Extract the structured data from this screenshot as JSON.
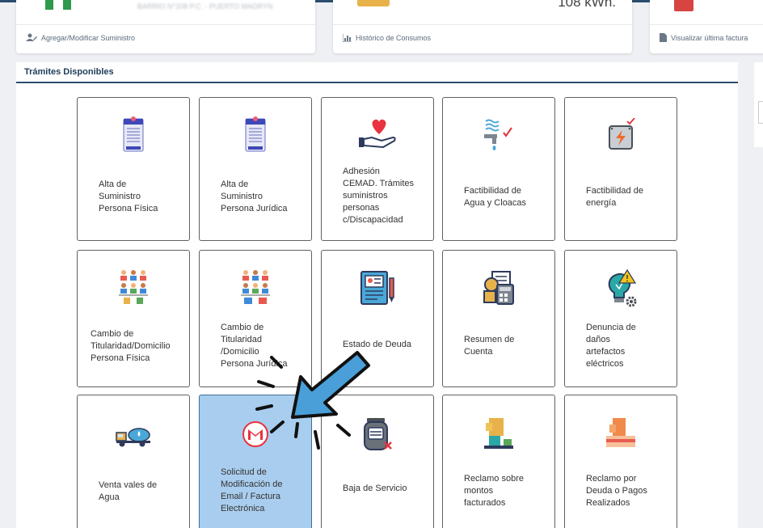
{
  "top_cards": [
    {
      "link_label": "Agregar/Modificar Suministro",
      "link_icon": "user-edit-icon",
      "address": "BARRIO N°208 P.C. - PUERTO MADRYN"
    },
    {
      "link_label": "Histórico de Consumos",
      "link_icon": "bar-chart-icon",
      "value_text": "108 kWh."
    },
    {
      "link_label": "Visualizar última factura",
      "link_icon": "document-icon"
    }
  ],
  "panel": {
    "title": "Trámites Disponibles"
  },
  "tiles": [
    {
      "label_lines": [
        "Alta de",
        "Suministro",
        "Persona Física"
      ],
      "icon": "form-icon"
    },
    {
      "label_lines": [
        "Alta de",
        "Suministro",
        "Persona Jurídica"
      ],
      "icon": "form-icon"
    },
    {
      "label_lines": [
        "Adhesión",
        "CEMAD. Trámites",
        "suministros",
        "personas",
        "c/Discapacidad"
      ],
      "icon": "heart-hand-icon"
    },
    {
      "label_lines": [
        "Factibilidad de",
        "Agua y Cloacas"
      ],
      "icon": "water-faucet-icon"
    },
    {
      "label_lines": [
        "Factibilidad de",
        "energía"
      ],
      "icon": "electric-box-icon"
    },
    {
      "label_lines": [
        "Cambio de",
        "Titularidad/Domicilio",
        "Persona Física"
      ],
      "icon": "people-group-icon"
    },
    {
      "label_lines": [
        "Cambio de",
        "Titularidad",
        "/Domicilio",
        "Persona Jurídica"
      ],
      "icon": "people-business-icon"
    },
    {
      "label_lines": [
        "Estado de Deuda"
      ],
      "icon": "document-pen-icon"
    },
    {
      "label_lines": [
        "Resumen de",
        "Cuenta"
      ],
      "icon": "calculator-icon"
    },
    {
      "label_lines": [
        "Denuncia de",
        "daños",
        "artefactos",
        "eléctricos"
      ],
      "icon": "bulb-warning-icon"
    },
    {
      "label_lines": [
        "Venta vales de",
        "Agua"
      ],
      "icon": "water-truck-icon"
    },
    {
      "label_lines": [
        "Solicitud de",
        "Modificación de",
        "Email / Factura",
        "Electrónica"
      ],
      "icon": "gmail-icon"
    },
    {
      "label_lines": [
        "Baja de Servicio"
      ],
      "icon": "meter-remove-icon"
    },
    {
      "label_lines": [
        "Reclamo sobre",
        "montos",
        "facturados"
      ],
      "icon": "hand-complaint-icon"
    },
    {
      "label_lines": [
        "Reclamo por",
        "Deuda o Pagos",
        "Realizados"
      ],
      "icon": "payment-icon"
    }
  ],
  "colors": {
    "header_line": "#2a4d6e",
    "active_tile": "#a9cdee",
    "arrow": "#4a9fd8"
  }
}
